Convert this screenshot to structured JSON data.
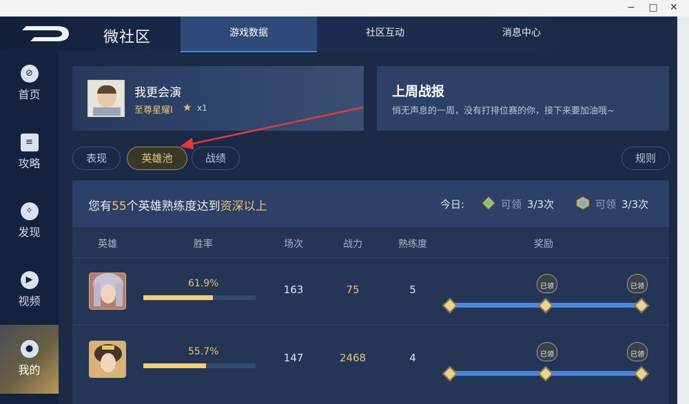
{
  "window": {
    "minimize": "−",
    "maximize": "□",
    "close": "✕"
  },
  "header": {
    "title": "微社区",
    "tabs": [
      {
        "label": "游戏数据",
        "active": true
      },
      {
        "label": "社区互动",
        "active": false
      },
      {
        "label": "消息中心",
        "active": false
      }
    ]
  },
  "sidebar": {
    "items": [
      {
        "label": "首页",
        "icon": "home-icon"
      },
      {
        "label": "攻略",
        "icon": "guide-icon"
      },
      {
        "label": "发现",
        "icon": "compass-icon"
      },
      {
        "label": "视频",
        "icon": "play-icon"
      },
      {
        "label": "我的",
        "icon": "user-icon",
        "active": true
      }
    ]
  },
  "profile": {
    "name": "我更会演",
    "rank": "至尊星耀I",
    "star_count": "x1"
  },
  "weekly": {
    "title": "上周战报",
    "subtitle": "悄无声息的一周，没有打排位赛的你，接下来要加油哦~"
  },
  "subtabs": {
    "perf": "表现",
    "heroes": "英雄池",
    "record": "战绩",
    "rules": "规则"
  },
  "summary": {
    "prefix": "您有",
    "count": "55",
    "middle": "个英雄熟练度达到",
    "level": "资深以上"
  },
  "today": {
    "label": "今日:",
    "rewards": [
      {
        "status": "可领",
        "count": "3/3次"
      },
      {
        "status": "可领",
        "count": "3/3次"
      }
    ]
  },
  "columns": {
    "hero": "英雄",
    "winrate": "胜率",
    "matches": "场次",
    "power": "战力",
    "mastery": "熟练度",
    "reward": "奖励"
  },
  "heroes": [
    {
      "winrate": "61.9%",
      "winrate_value": 0.619,
      "matches": "163",
      "power": "75",
      "mastery": "5",
      "claimed_label": "已领"
    },
    {
      "winrate": "55.7%",
      "winrate_value": 0.557,
      "matches": "147",
      "power": "2468",
      "mastery": "4",
      "claimed_label": "已领"
    }
  ],
  "colors": {
    "accent_gold": "#e8c46b",
    "track_blue": "#4a86e0",
    "bg": "#1b2a47"
  }
}
